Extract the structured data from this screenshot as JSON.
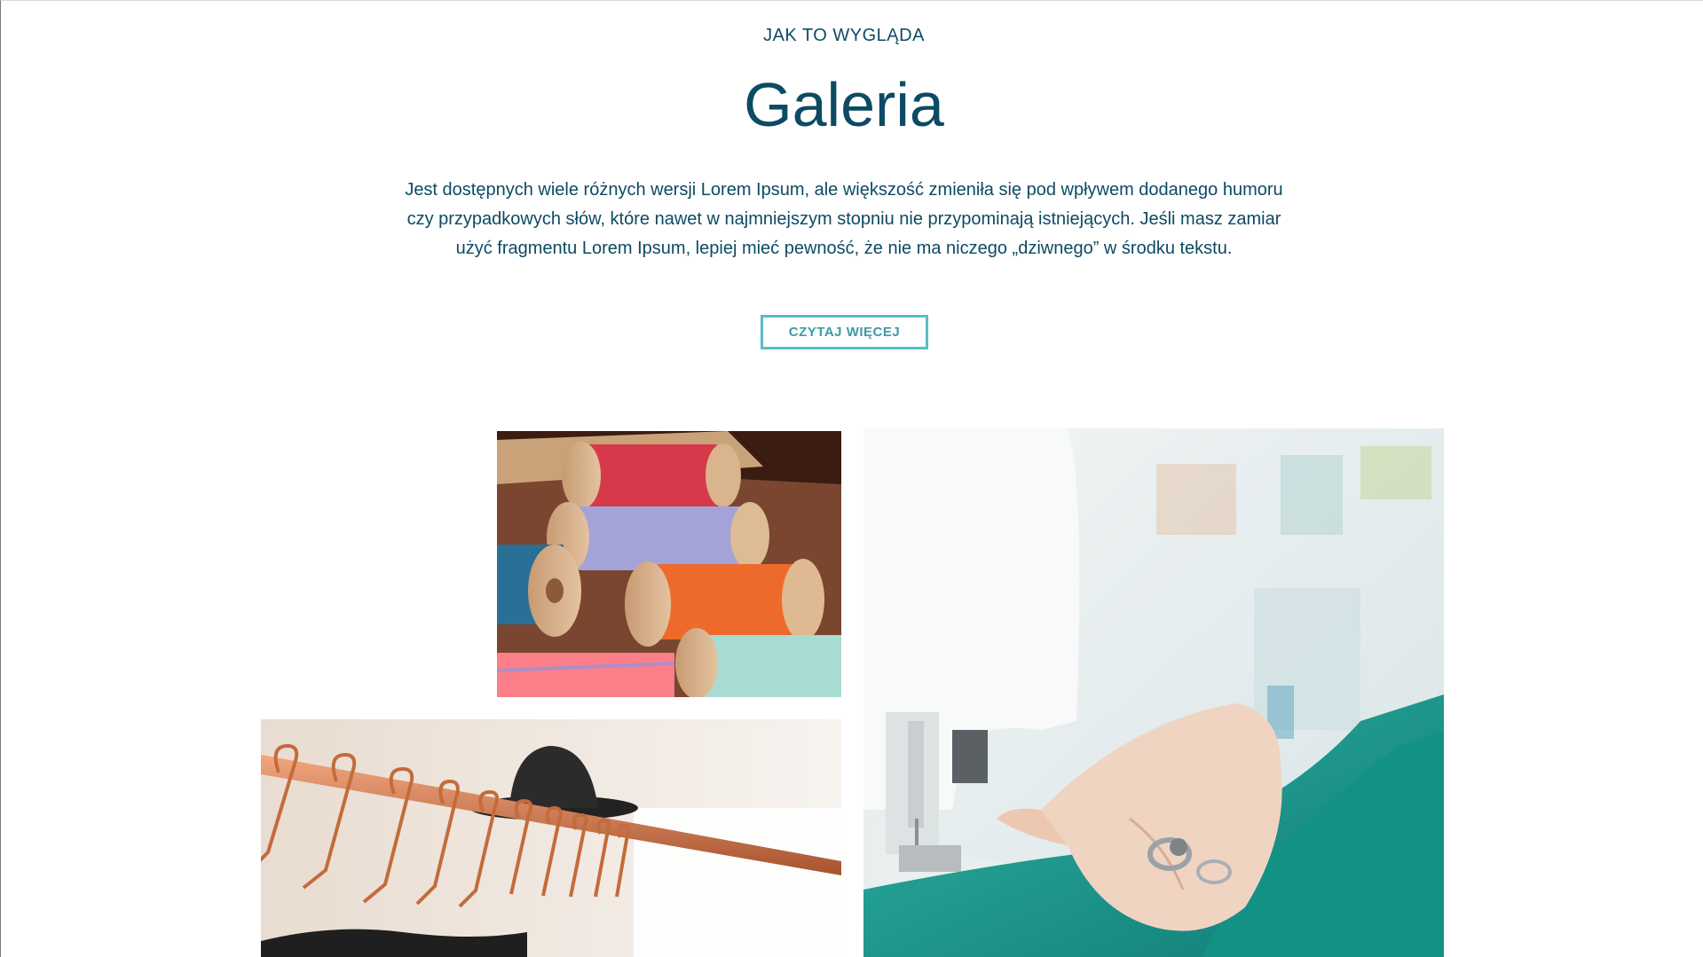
{
  "section": {
    "eyebrow": "JAK TO WYGLĄDA",
    "title": "Galeria",
    "lead": "Jest dostępnych wiele różnych wersji Lorem Ipsum, ale większość zmieniła się pod wpływem dodanego humoru czy przypadkowych słów, które nawet w najmniejszym stopniu nie przypominają istniejących. Jeśli masz zamiar użyć fragmentu Lorem Ipsum, lepiej mieć pewność, że nie ma niczego „dziwnego” w środku tekstu.",
    "button_label": "CZYTAJ WIĘCEJ"
  },
  "gallery": {
    "images": [
      {
        "subject": "thread-spools-photo"
      },
      {
        "subject": "sewing-machine-photo"
      },
      {
        "subject": "copper-hangers-photo"
      }
    ]
  },
  "colors": {
    "heading": "#0d4a63",
    "button_border": "#5bbcc7",
    "button_text": "#3d9aa6"
  }
}
